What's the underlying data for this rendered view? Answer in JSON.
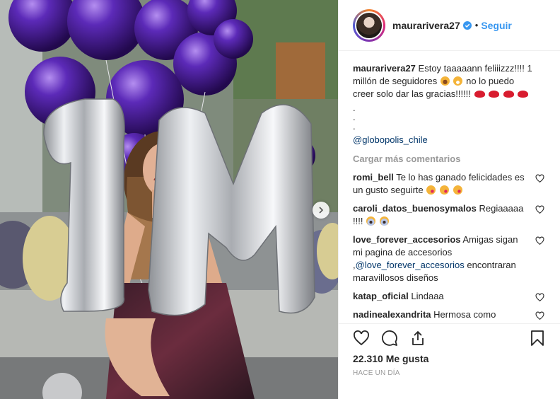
{
  "post": {
    "username": "maurarivera27",
    "follow_label": "Seguir",
    "dot": "•"
  },
  "caption": {
    "username": "maurarivera27",
    "text_1": "Estoy taaaaann feliiizzz!!!! 1 millón de seguidores",
    "text_2": "no lo puedo creer solo dar las gracias!!!!!!",
    "dots": [
      ".",
      ".",
      "."
    ],
    "mention": "@globopolis_chile"
  },
  "load_more_label": "Cargar más comentarios",
  "comments": [
    {
      "user": "romi_bell",
      "text": "Te lo has ganado felicidades es un gusto seguirte"
    },
    {
      "user": "caroli_datos_buenosymalos",
      "text": "Regiaaaaa !!!!"
    },
    {
      "user": "love_forever_accesorios",
      "text_1": "Amigas sigan mi pagina de accesorios ,",
      "mention": "@love_forever_accesorios",
      "text_2": "encontraran maravillosos diseños"
    },
    {
      "user": "katap_oficial",
      "text": "Lindaaa"
    },
    {
      "user": "nadinealexandrita",
      "text": "Hermosa como"
    }
  ],
  "likes_label": "22.310 Me gusta",
  "timestamp": "Hace un día",
  "icons": {
    "like": "heart-icon",
    "comment": "comment-icon",
    "share": "share-icon",
    "save": "bookmark-icon",
    "verified": "verified-badge-icon",
    "next": "chevron-right-icon"
  },
  "colors": {
    "link_blue": "#3897f0",
    "mention": "#003569",
    "muted": "#999999",
    "text": "#262626"
  }
}
